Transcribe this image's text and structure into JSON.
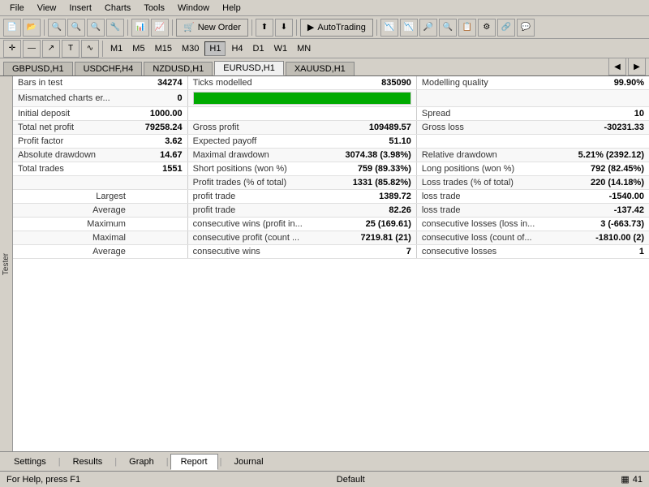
{
  "menu": {
    "items": [
      "File",
      "View",
      "Insert",
      "Charts",
      "Tools",
      "Window",
      "Help"
    ]
  },
  "timeframes": {
    "items": [
      "M1",
      "M5",
      "M15",
      "M30",
      "H1",
      "H4",
      "D1",
      "W1",
      "MN"
    ],
    "active": "H1"
  },
  "chart_tabs": {
    "items": [
      "GBPUSD,H1",
      "USDCHF,H4",
      "NZDUSD,H1",
      "EURUSD,H1",
      "XAUUSD,H1"
    ],
    "active": "EURUSD,H1"
  },
  "side_label": "Tester",
  "report": {
    "rows": [
      {
        "label1": "Bars in test",
        "val1": "34274",
        "label2": "Ticks modelled",
        "val2": "835090",
        "label3": "Modelling quality",
        "val3": "99.90%",
        "type": "normal"
      },
      {
        "label1": "Mismatched charts er...",
        "val1": "0",
        "label2": "",
        "val2": "bar",
        "label3": "",
        "val3": "",
        "type": "bar"
      },
      {
        "label1": "Initial deposit",
        "val1": "1000.00",
        "label2": "",
        "val2": "",
        "label3": "Spread",
        "val3": "10",
        "type": "normal"
      },
      {
        "label1": "Total net profit",
        "val1": "79258.24",
        "label2": "Gross profit",
        "val2": "109489.57",
        "label3": "Gross loss",
        "val3": "-30231.33",
        "type": "normal"
      },
      {
        "label1": "Profit factor",
        "val1": "3.62",
        "label2": "Expected payoff",
        "val2": "51.10",
        "label3": "",
        "val3": "",
        "type": "normal"
      },
      {
        "label1": "Absolute drawdown",
        "val1": "14.67",
        "label2": "Maximal drawdown",
        "val2": "3074.38 (3.98%)",
        "label3": "Relative drawdown",
        "val3": "5.21% (2392.12)",
        "type": "normal"
      },
      {
        "label1": "Total trades",
        "val1": "1551",
        "label2": "Short positions (won %)",
        "val2": "759 (89.33%)",
        "label3": "Long positions (won %)",
        "val3": "792 (82.45%)",
        "type": "normal"
      },
      {
        "label1": "",
        "val1": "",
        "label2": "Profit trades (% of total)",
        "val2": "1331 (85.82%)",
        "label3": "Loss trades (% of total)",
        "val3": "220 (14.18%)",
        "type": "normal"
      },
      {
        "label1": "Largest",
        "val1": "",
        "label2": "profit trade",
        "val2": "1389.72",
        "label3": "loss trade",
        "val3": "-1540.00",
        "type": "header"
      },
      {
        "label1": "Average",
        "val1": "",
        "label2": "profit trade",
        "val2": "82.26",
        "label3": "loss trade",
        "val3": "-137.42",
        "type": "header"
      },
      {
        "label1": "Maximum",
        "val1": "",
        "label2": "consecutive wins (profit in...",
        "val2": "25 (169.61)",
        "label3": "consecutive losses (loss in...",
        "val3": "3 (-663.73)",
        "type": "header"
      },
      {
        "label1": "Maximal",
        "val1": "",
        "label2": "consecutive profit (count ...",
        "val2": "7219.81 (21)",
        "label3": "consecutive loss (count of...",
        "val3": "-1810.00 (2)",
        "type": "header"
      },
      {
        "label1": "Average",
        "val1": "",
        "label2": "consecutive wins",
        "val2": "7",
        "label3": "consecutive losses",
        "val3": "1",
        "type": "header"
      }
    ]
  },
  "bottom_tabs": {
    "items": [
      "Settings",
      "Results",
      "Graph",
      "Report",
      "Journal"
    ],
    "active": "Report"
  },
  "status_bar": {
    "help_text": "For Help, press F1",
    "default_text": "Default",
    "indicator": "41"
  },
  "toolbar": {
    "new_order": "New Order",
    "autotrading": "AutoTrading"
  }
}
